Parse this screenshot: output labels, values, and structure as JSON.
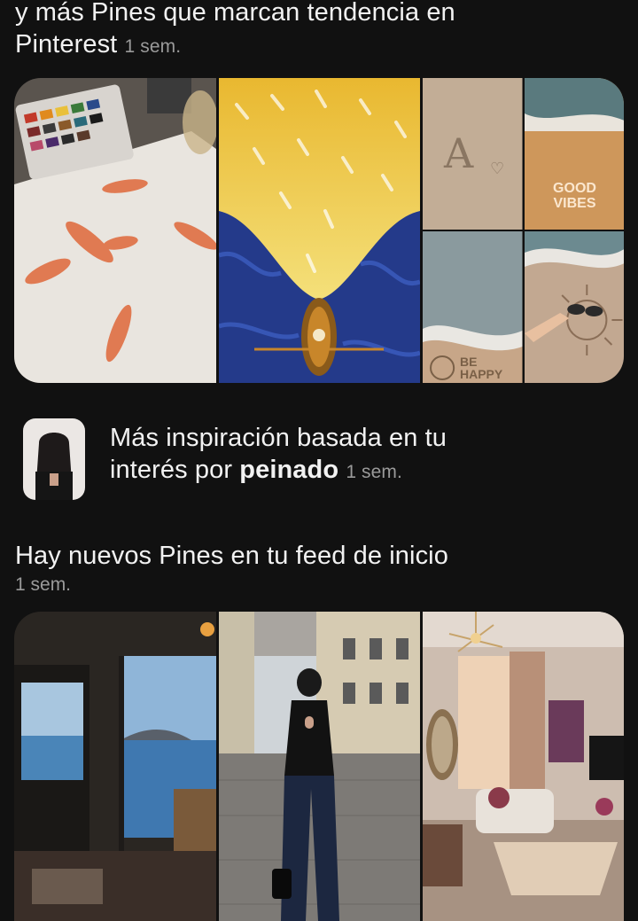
{
  "updates": [
    {
      "title_line1": "y más Pines que marcan tendencia en",
      "title_line2": "Pinterest",
      "time": "1 sem."
    },
    {
      "text_line1": "Más inspiración basada en tu",
      "text_prefix": "interés por ",
      "interest": "peinado",
      "time": "1 sem."
    },
    {
      "title": "Hay nuevos Pines en tu feed de inicio",
      "time": "1 sem."
    }
  ],
  "images": {
    "sand_letter": "A",
    "sand_words": "GOOD VIBES",
    "sand_happy": "BE HAPPY"
  }
}
